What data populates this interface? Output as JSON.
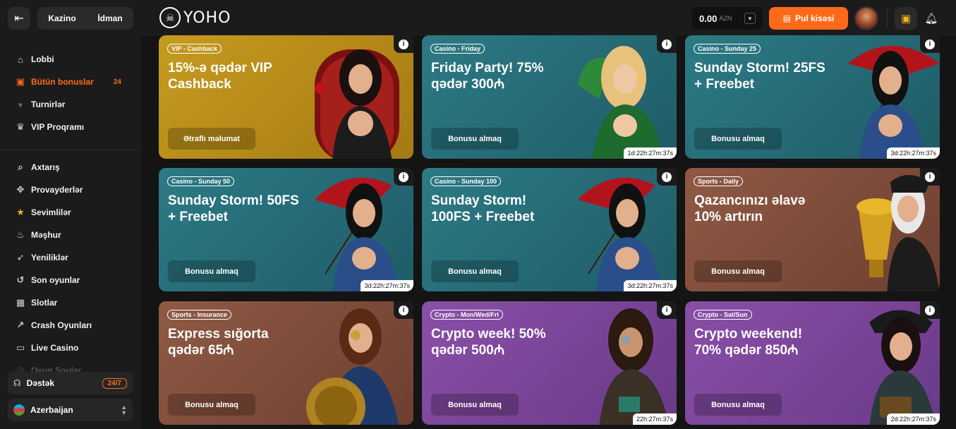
{
  "sidebar": {
    "modes": [
      "Kazino",
      "İdman"
    ],
    "primary": [
      {
        "label": "Lobbi",
        "icon": "home-icon"
      },
      {
        "label": "Bütün bonuslar",
        "icon": "gift-icon",
        "badge": "24",
        "active": true
      },
      {
        "label": "Turnirlər",
        "icon": "trophy-icon"
      },
      {
        "label": "VIP Proqramı",
        "icon": "crown-icon"
      }
    ],
    "secondary": [
      {
        "label": "Axtarış",
        "icon": "search-icon"
      },
      {
        "label": "Provayderlər",
        "icon": "joystick-icon"
      },
      {
        "label": "Sevimlilər",
        "icon": "star-icon"
      },
      {
        "label": "Məşhur",
        "icon": "fire-icon"
      },
      {
        "label": "Yeniliklər",
        "icon": "rocket-icon"
      },
      {
        "label": "Son oyunlar",
        "icon": "history-icon"
      },
      {
        "label": "Slotlar",
        "icon": "slot-icon"
      },
      {
        "label": "Crash Oyunları",
        "icon": "crash-icon"
      },
      {
        "label": "Live Casino",
        "icon": "tv-icon"
      },
      {
        "label": "Oyun Şoular",
        "icon": "show-icon"
      }
    ],
    "support_label": "Dəstək",
    "support_badge": "24/7",
    "language": "Azerbaijan"
  },
  "header": {
    "logo_text": "YOHO",
    "balance": "0.00",
    "currency": "AZN",
    "wallet_label": "Pul kisəsi"
  },
  "cards": [
    {
      "chip": "VIP - Cashback",
      "title": "15%-ə qədər VIP Cashback",
      "cta": "Ətraflı məlumat",
      "timer": "",
      "theme": "gold"
    },
    {
      "chip": "Casino - Friday",
      "title": "Friday Party! 75% qədər 300₼",
      "cta": "Bonusu almaq",
      "timer": "1d:22h:27m:37s",
      "theme": "teal"
    },
    {
      "chip": "Casino - Sunday 25",
      "title": "Sunday Storm! 25FS + Freebet",
      "cta": "Bonusu almaq",
      "timer": "3d:22h:27m:37s",
      "theme": "teal"
    },
    {
      "chip": "Casino - Sunday 50",
      "title": "Sunday Storm! 50FS + Freebet",
      "cta": "Bonusu almaq",
      "timer": "3d:22h:27m:37s",
      "theme": "teal"
    },
    {
      "chip": "Casino - Sunday 100",
      "title": "Sunday Storm! 100FS + Freebet",
      "cta": "Bonusu almaq",
      "timer": "3d:22h:27m:37s",
      "theme": "teal"
    },
    {
      "chip": "Sports - Daily",
      "title": "Qazancınızı əlavə 10% artırın",
      "cta": "Bonusu almaq",
      "timer": "",
      "theme": "brown"
    },
    {
      "chip": "Sports - Insurance",
      "title": "Express sığorta qədər 65₼",
      "cta": "Bonusu almaq",
      "timer": "",
      "theme": "brown"
    },
    {
      "chip": "Crypto - Mon/Wed/Fri",
      "title": "Crypto week! 50% qədər 500₼",
      "cta": "Bonusu almaq",
      "timer": "22h:27m:37s",
      "theme": "purple"
    },
    {
      "chip": "Crypto - Sat/Sun",
      "title": "Crypto weekend! 70% qədər 850₼",
      "cta": "Bonusu almaq",
      "timer": "2d:22h:27m:37s",
      "theme": "purple"
    }
  ]
}
